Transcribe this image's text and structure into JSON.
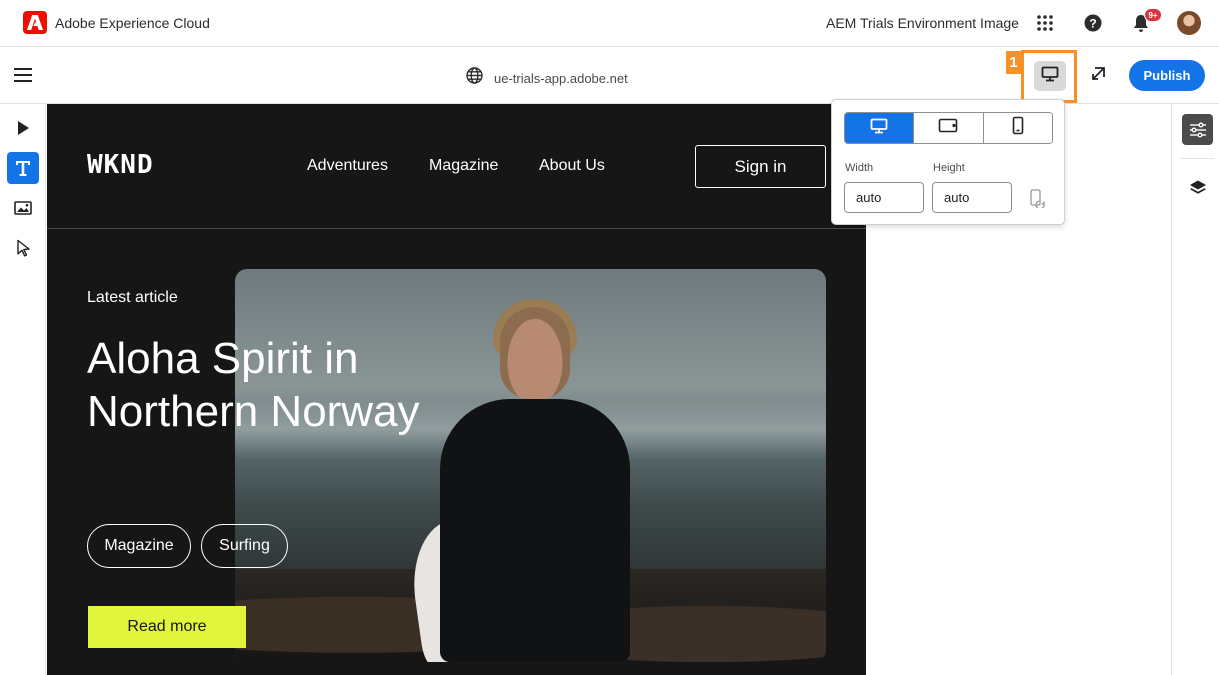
{
  "shell": {
    "brand_name": "Adobe Experience Cloud",
    "org_name": "AEM Trials Environment Image",
    "notifications_badge": "9+",
    "icons": [
      "adobe-logo-icon",
      "app-grid-icon",
      "help-icon",
      "bell-icon",
      "avatar"
    ]
  },
  "toolbar": {
    "url": "ue-trials-app.adobe.net",
    "callout_number": "1",
    "publish_label": "Publish",
    "icons": [
      "hamburger-icon",
      "globe-icon",
      "desktop-icon",
      "open-in-new-window-icon"
    ]
  },
  "left_rail": {
    "tools": [
      "preview-play-icon",
      "text-icon",
      "image-icon",
      "select-cursor-icon"
    ],
    "active_tool": "text-icon"
  },
  "right_rail": {
    "tools": [
      "properties-sliders-icon",
      "layers-icon"
    ],
    "active_tool": "properties-sliders-icon"
  },
  "emulator": {
    "devices": [
      "desktop-icon",
      "tablet-icon",
      "mobile-icon"
    ],
    "selected": "desktop-icon",
    "width_label": "Width",
    "width_value": "auto",
    "height_label": "Height",
    "height_value": "auto"
  },
  "site": {
    "logo": "WKND",
    "nav": [
      "Adventures",
      "Magazine",
      "About Us"
    ],
    "signin_label": "Sign in",
    "kicker": "Latest article",
    "headline": "Aloha Spirit in Northern Norway",
    "tags": [
      "Magazine",
      "Surfing"
    ],
    "cta_label": "Read more"
  },
  "colors": {
    "accent_blue": "#1473e6",
    "adobe_red": "#eb1000",
    "callout_orange": "#f59128",
    "site_background": "#161616",
    "cta_yellow": "#e0f53b"
  }
}
